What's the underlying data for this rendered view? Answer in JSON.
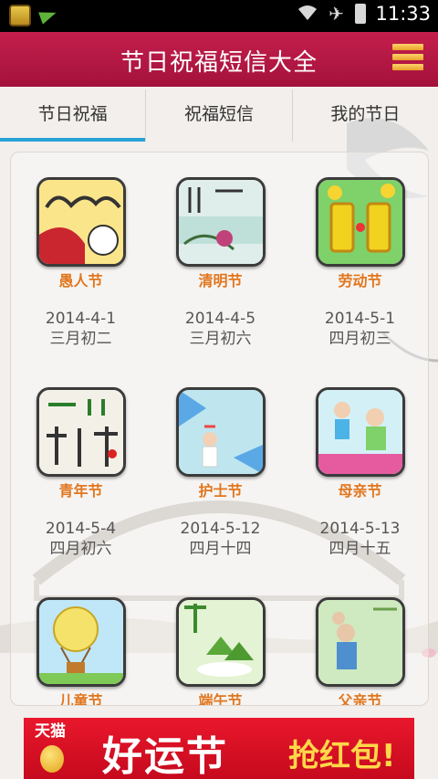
{
  "statusbar": {
    "time": "11:33"
  },
  "header": {
    "title": "节日祝福短信大全"
  },
  "tabs": [
    {
      "label": "节日祝福",
      "active": true
    },
    {
      "label": "祝福短信",
      "active": false
    },
    {
      "label": "我的节日",
      "active": false
    }
  ],
  "festivals": [
    {
      "name": "愚人节",
      "date": "2014-4-1",
      "lunar": "三月初二"
    },
    {
      "name": "清明节",
      "date": "2014-4-5",
      "lunar": "三月初六"
    },
    {
      "name": "劳动节",
      "date": "2014-5-1",
      "lunar": "四月初三"
    },
    {
      "name": "青年节",
      "date": "2014-5-4",
      "lunar": "四月初六"
    },
    {
      "name": "护士节",
      "date": "2014-5-12",
      "lunar": "四月十四"
    },
    {
      "name": "母亲节",
      "date": "2014-5-13",
      "lunar": "四月十五"
    },
    {
      "name": "儿童节",
      "date": "",
      "lunar": ""
    },
    {
      "name": "端午节",
      "date": "",
      "lunar": ""
    },
    {
      "name": "父亲节",
      "date": "",
      "lunar": ""
    }
  ],
  "ad": {
    "tmall": "天猫",
    "main": "好运节",
    "sub": "抢红包!"
  },
  "colors": {
    "header": "#b5163f",
    "tab_indicator": "#28a3d6",
    "festival_name": "#e1761f"
  }
}
